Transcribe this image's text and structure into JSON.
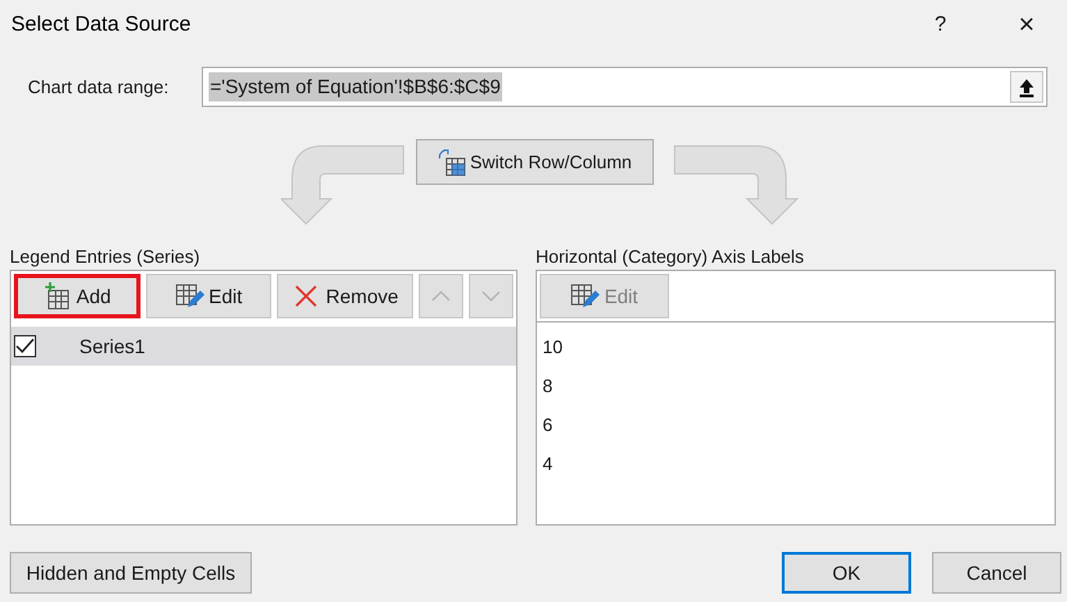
{
  "window": {
    "title": "Select Data Source",
    "help": "?",
    "close": "×"
  },
  "chart_data_range": {
    "label": "Chart data range:",
    "value": "='System of Equation'!$B$6:$C$9",
    "value_selected": true
  },
  "switch_button": {
    "label": "Switch Row/Column"
  },
  "legend_entries": {
    "label": "Legend Entries (Series)",
    "toolbar": [
      {
        "kind": "add",
        "label": "Add",
        "highlighted": true,
        "disabled": false
      },
      {
        "kind": "edit",
        "label": "Edit",
        "highlighted": false,
        "disabled": false
      },
      {
        "kind": "remove",
        "label": "Remove",
        "highlighted": false,
        "disabled": false
      },
      {
        "kind": "up",
        "highlighted": false,
        "disabled": true
      },
      {
        "kind": "down",
        "highlighted": false,
        "disabled": true
      }
    ],
    "series": [
      {
        "name": "Series1",
        "checked": true,
        "selected": true
      }
    ]
  },
  "axis_labels": {
    "label": "Horizontal (Category) Axis Labels",
    "edit": {
      "label": "Edit",
      "disabled": true
    },
    "items": [
      "10",
      "8",
      "6",
      "4"
    ]
  },
  "buttons": [
    {
      "label": "Hidden and Empty Cells",
      "default": false
    },
    {
      "label": "OK",
      "default": true
    },
    {
      "label": "Cancel",
      "default": false
    }
  ]
}
